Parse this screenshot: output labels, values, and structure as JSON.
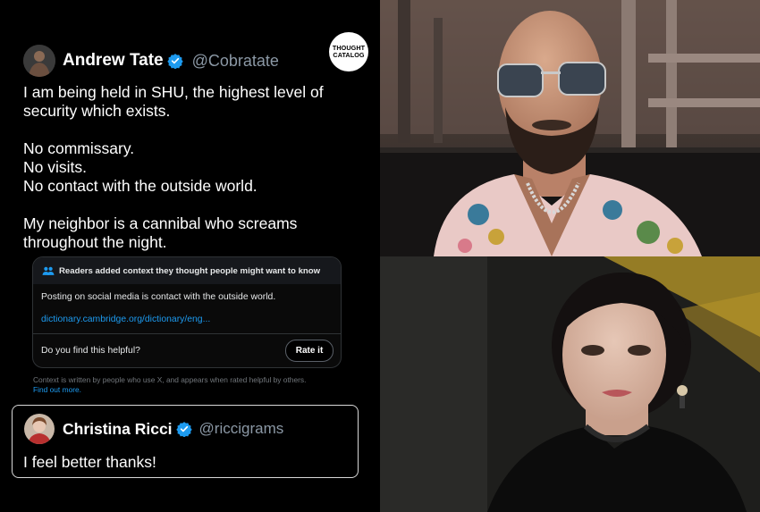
{
  "tweet": {
    "author_name": "Andrew Tate",
    "author_handle": "@Cobratate",
    "verified_icon": "verified-badge-icon",
    "lines": [
      "I am being held in SHU, the highest level of",
      "security which exists.",
      "No commissary.",
      "No visits.",
      "No contact with the outside world.",
      "My neighbor is a cannibal who screams",
      "throughout the night."
    ]
  },
  "logo": {
    "line1": "THOUGHT",
    "line2": "CATALOG"
  },
  "community_note": {
    "header": "Readers added context they thought people might want to know",
    "header_icon": "people-icon",
    "text": "Posting on social media is contact with the outside world.",
    "link": "dictionary.cambridge.org/dictionary/eng...",
    "question": "Do you find this helpful?",
    "rate_button": "Rate it",
    "footer": "Context is written by people who use X, and appears when rated helpful by others.",
    "footer_link": "Find out more."
  },
  "reply": {
    "author_name": "Christina Ricci",
    "author_handle": "@riccigrams",
    "text": "I feel better thanks!"
  },
  "colors": {
    "background": "#000000",
    "link_blue": "#1d9bf0",
    "verified_blue": "#1d9bf0",
    "secondary_text": "#8b98a5"
  }
}
